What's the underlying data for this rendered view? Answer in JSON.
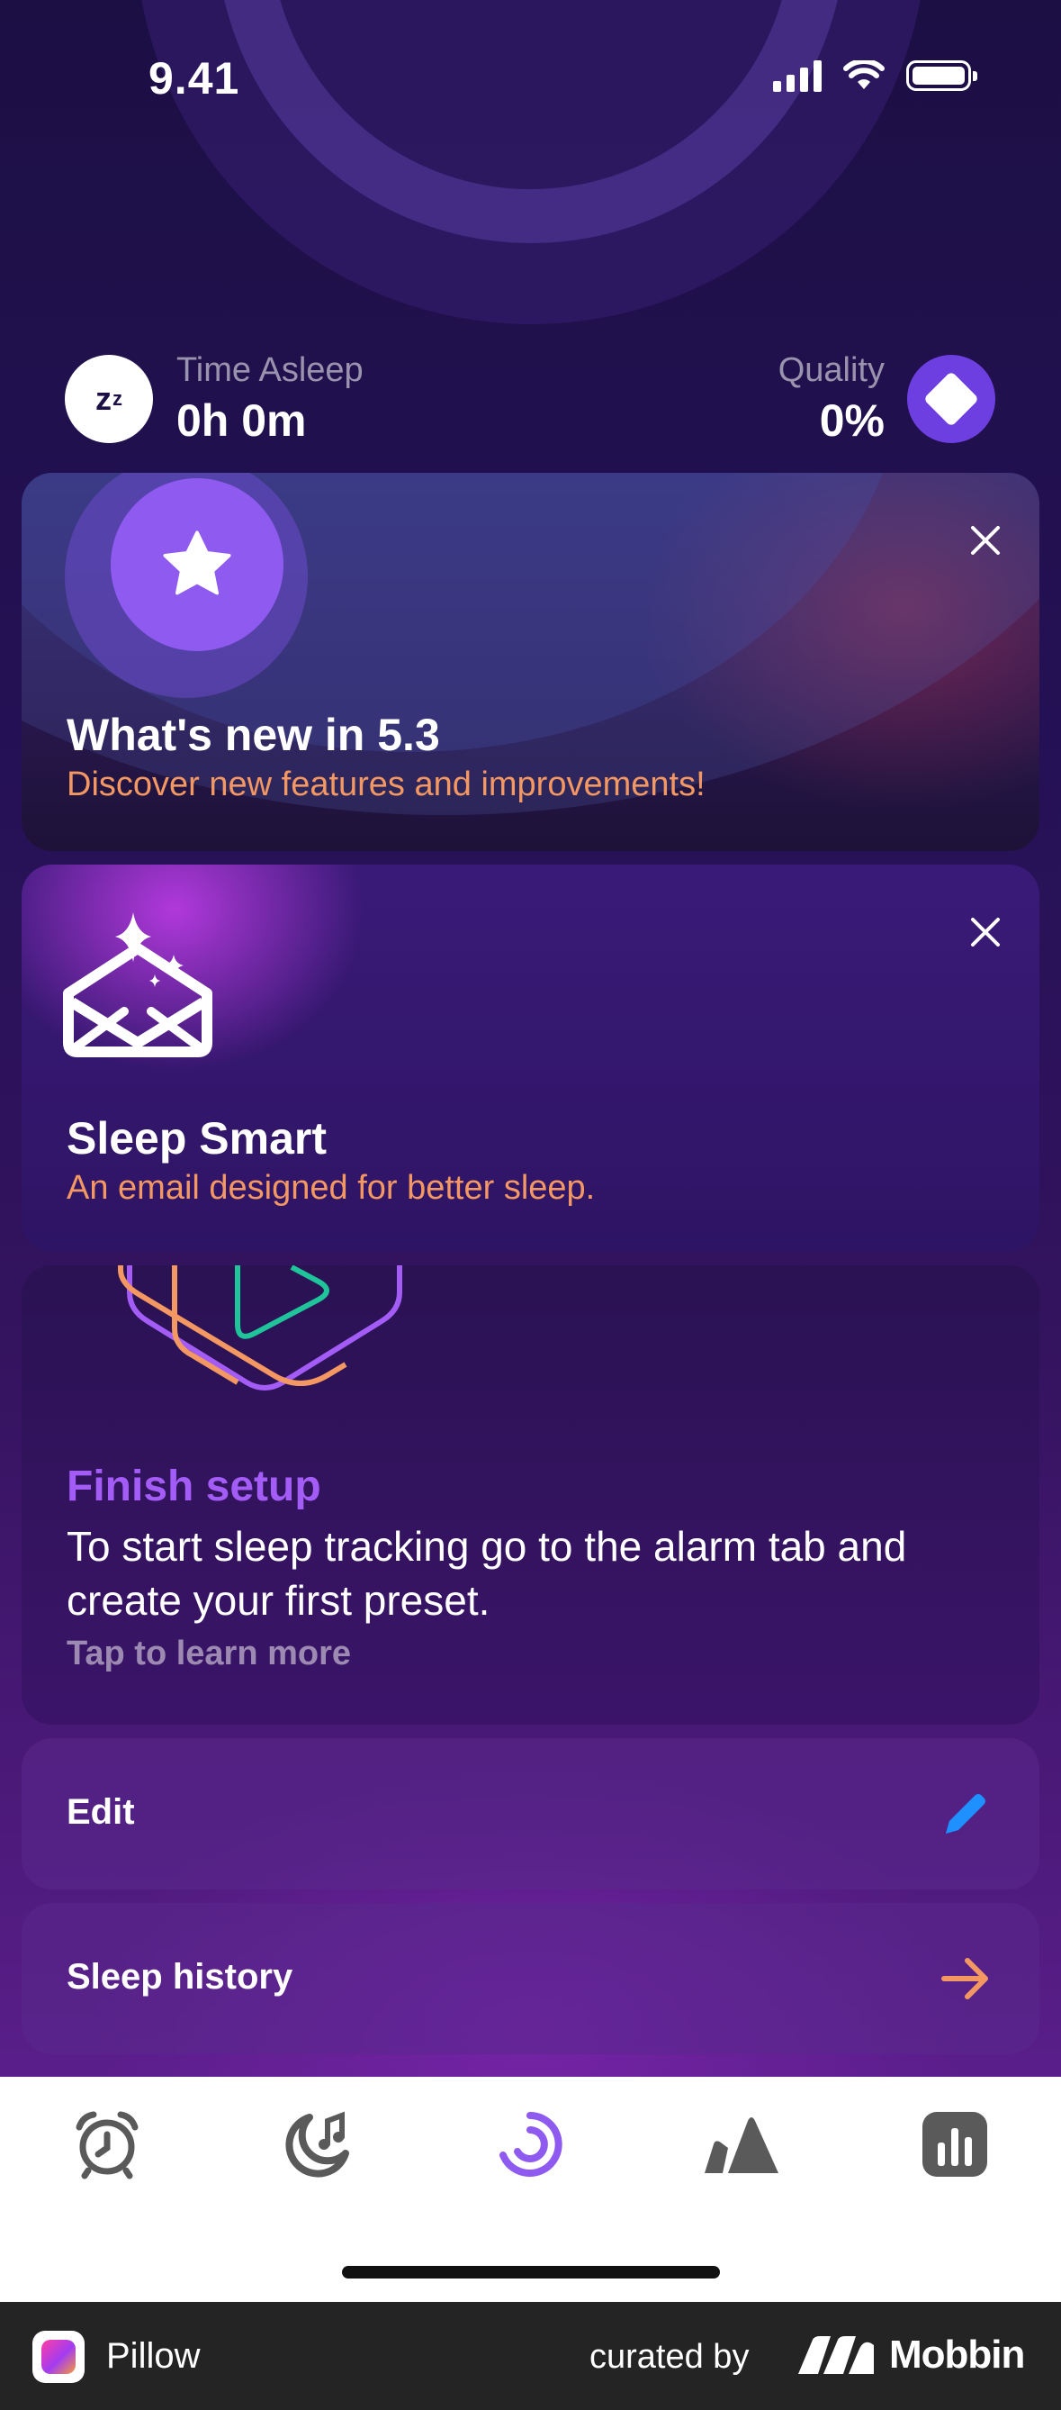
{
  "status_bar": {
    "time": "9.41",
    "icons": [
      "cellular-signal-icon",
      "wifi-icon",
      "battery-icon"
    ]
  },
  "stats": {
    "time_asleep": {
      "label": "Time Asleep",
      "value": "0h 0m",
      "icon": "zz-icon"
    },
    "quality": {
      "label": "Quality",
      "value": "0%",
      "icon": "diamond-icon"
    }
  },
  "cards": {
    "whats_new": {
      "title": "What's new in 5.3",
      "subtitle": "Discover new features and improvements!",
      "icon": "star-icon"
    },
    "sleep_smart": {
      "title": "Sleep Smart",
      "subtitle": "An email designed for better sleep.",
      "icon": "envelope-sparkle-icon"
    },
    "finish_setup": {
      "title": "Finish setup",
      "body": "To start sleep tracking go to the alarm tab and create your first preset.",
      "link": "Tap to learn more"
    }
  },
  "rows": {
    "edit": {
      "label": "Edit",
      "icon": "pencil-icon"
    },
    "sleep_history": {
      "label": "Sleep history",
      "icon": "arrow-right-icon"
    }
  },
  "tab_bar": {
    "tabs": [
      {
        "icon": "alarm-clock-icon",
        "active": false
      },
      {
        "icon": "moon-sound-icon",
        "active": false
      },
      {
        "icon": "sleep-ring-icon",
        "active": true
      },
      {
        "icon": "sound-peaks-icon",
        "active": false
      },
      {
        "icon": "stats-chart-icon",
        "active": false
      }
    ]
  },
  "footer": {
    "app_name": "Pillow",
    "curated_by": "curated by",
    "brand": "Mobbin"
  },
  "colors": {
    "accent_orange": "#f39763",
    "accent_purple": "#a35cf5",
    "active_tab": "#8e5af0",
    "edit_icon": "#1e90ff"
  }
}
